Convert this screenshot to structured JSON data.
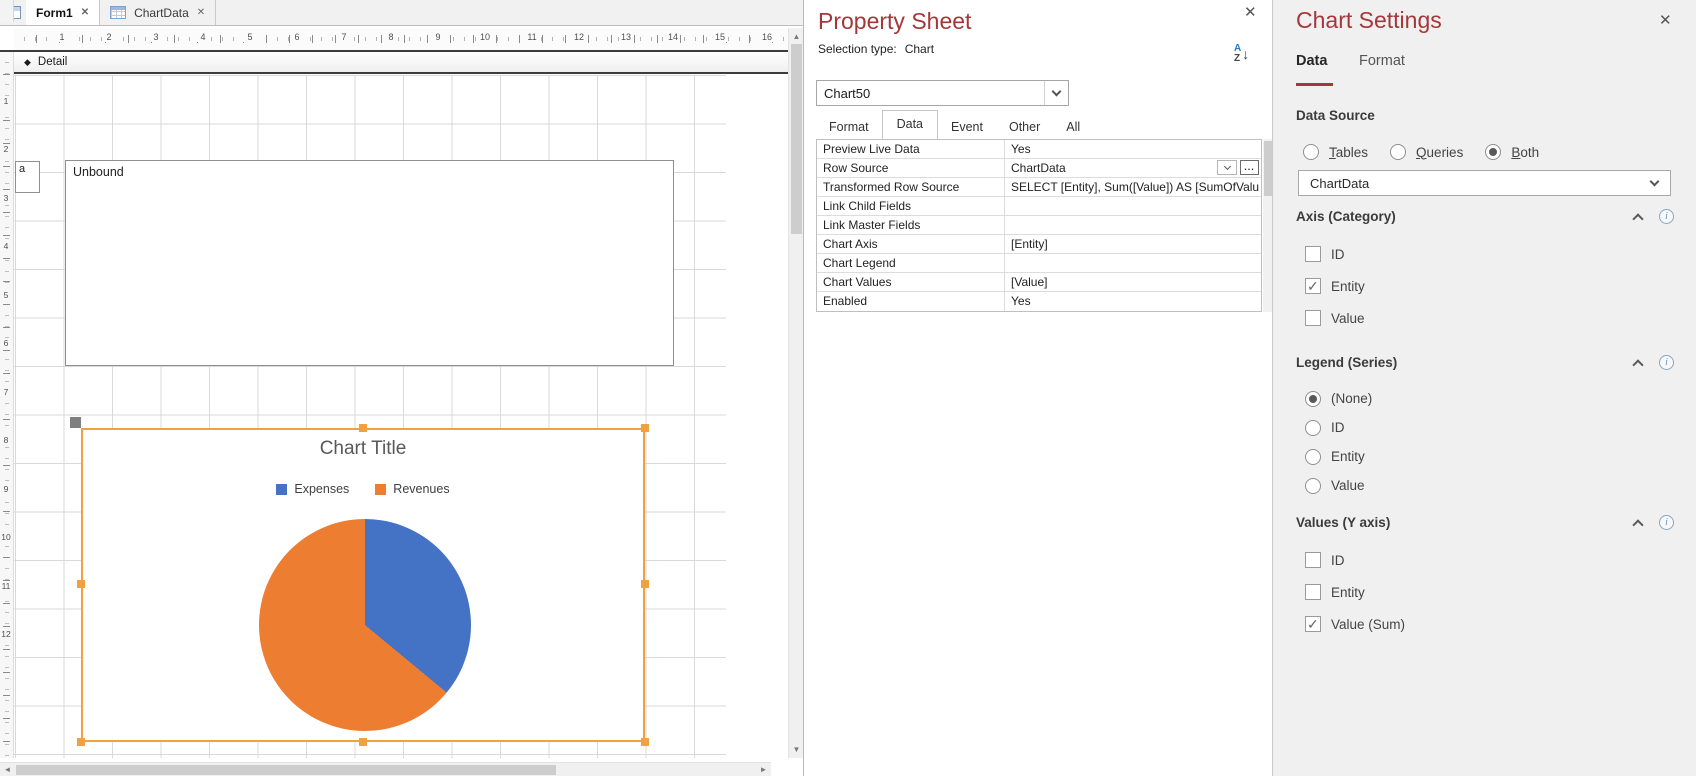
{
  "form_window": {
    "tabs": [
      {
        "label": "Form1",
        "close": "✕"
      },
      {
        "label": "ChartData",
        "close": "✕"
      }
    ],
    "detail_label": "Detail",
    "h_ruler": [
      "1",
      "2",
      "3",
      "4",
      "5",
      "6",
      "7",
      "8",
      "9",
      "10",
      "11",
      "12",
      "13",
      "14",
      "15",
      "16"
    ],
    "v_ruler": [
      "1",
      "2",
      "3",
      "4",
      "5",
      "6",
      "7",
      "8",
      "9",
      "10",
      "11",
      "12"
    ],
    "attached_label": "a",
    "unbound_text": "Unbound"
  },
  "chart": {
    "title": "Chart Title",
    "legend": [
      {
        "label": "Expenses",
        "color": "#4472C4"
      },
      {
        "label": "Revenues",
        "color": "#ED7D31"
      }
    ],
    "chart_data": {
      "type": "pie",
      "title": "Chart Title",
      "legend_position": "top",
      "slices": [
        {
          "label": "Expenses",
          "color": "#4472C4",
          "fraction": 0.36
        },
        {
          "label": "Revenues",
          "color": "#ED7D31",
          "fraction": 0.64
        }
      ]
    }
  },
  "property_sheet": {
    "title": "Property Sheet",
    "selection_type_label": "Selection type:",
    "selection_type_value": "Chart",
    "object_selector": "Chart50",
    "tabs": [
      "Format",
      "Data",
      "Event",
      "Other",
      "All"
    ],
    "active_tab": "Data",
    "rows": [
      {
        "name": "Preview Live Data",
        "value": "Yes"
      },
      {
        "name": "Row Source",
        "value": "ChartData"
      },
      {
        "name": "Transformed Row Source",
        "value": "SELECT [Entity], Sum([Value]) AS [SumOfValu"
      },
      {
        "name": "Link Child Fields",
        "value": ""
      },
      {
        "name": "Link Master Fields",
        "value": ""
      },
      {
        "name": "Chart Axis",
        "value": "[Entity]"
      },
      {
        "name": "Chart Legend",
        "value": ""
      },
      {
        "name": "Chart Values",
        "value": "[Value]"
      },
      {
        "name": "Enabled",
        "value": "Yes"
      }
    ],
    "row_source_buttons": {
      "dots": "..."
    }
  },
  "chart_settings": {
    "title": "Chart Settings",
    "close": "✕",
    "tabs": [
      {
        "label": "Data",
        "active": true
      },
      {
        "label": "Format",
        "active": false
      }
    ],
    "data_source": {
      "heading": "Data Source",
      "radios": [
        {
          "label": "Tables",
          "selected": false
        },
        {
          "label": "Queries",
          "selected": false
        },
        {
          "label": "Both",
          "selected": true
        }
      ],
      "dropdown_value": "ChartData"
    },
    "sections": [
      {
        "heading": "Axis (Category)",
        "type": "checkbox",
        "options": [
          {
            "label": "ID",
            "checked": false
          },
          {
            "label": "Entity",
            "checked": true
          },
          {
            "label": "Value",
            "checked": false
          }
        ]
      },
      {
        "heading": "Legend (Series)",
        "type": "radio",
        "options": [
          {
            "label": "(None)",
            "checked": true
          },
          {
            "label": "ID",
            "checked": false
          },
          {
            "label": "Entity",
            "checked": false
          },
          {
            "label": "Value",
            "checked": false
          }
        ]
      },
      {
        "heading": "Values (Y axis)",
        "type": "checkbox",
        "options": [
          {
            "label": "ID",
            "checked": false
          },
          {
            "label": "Entity",
            "checked": false
          },
          {
            "label": "Value (Sum)",
            "checked": true
          }
        ]
      }
    ]
  }
}
